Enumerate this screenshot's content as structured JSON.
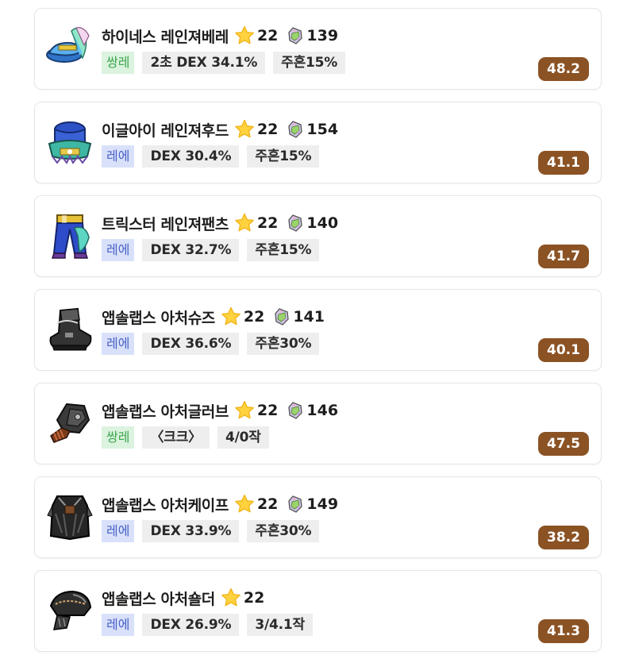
{
  "colors": {
    "score_badge": "#8b5224",
    "grade_ssang_bg": "#dcf3df",
    "grade_ssang_text": "#3aa64c",
    "grade_rare_bg": "#d9e1fa",
    "grade_rare_text": "#4a62c7",
    "stat_bg": "#eeeeee",
    "card_border": "#e6e6e6"
  },
  "items": [
    {
      "name": "하이네스 레인져베레",
      "icon": "highness-ranger-beret-icon",
      "stars": "22",
      "gem": "139",
      "grade": "쌍레",
      "grade_type": "ssang",
      "stats": [
        "2초 DEX 34.1%",
        "주흔15%"
      ],
      "score": "48.2"
    },
    {
      "name": "이글아이 레인져후드",
      "icon": "eagle-eye-ranger-hood-icon",
      "stars": "22",
      "gem": "154",
      "grade": "레에",
      "grade_type": "rare",
      "stats": [
        "DEX 30.4%",
        "주흔15%"
      ],
      "score": "41.1"
    },
    {
      "name": "트릭스터 레인져팬츠",
      "icon": "trickster-ranger-pants-icon",
      "stars": "22",
      "gem": "140",
      "grade": "레에",
      "grade_type": "rare",
      "stats": [
        "DEX 32.7%",
        "주흔15%"
      ],
      "score": "41.7"
    },
    {
      "name": "앱솔랩스 아처슈즈",
      "icon": "absolab-archer-shoes-icon",
      "stars": "22",
      "gem": "141",
      "grade": "레에",
      "grade_type": "rare",
      "stats": [
        "DEX 36.6%",
        "주흔30%"
      ],
      "score": "40.1"
    },
    {
      "name": "앱솔랩스 아처글러브",
      "icon": "absolab-archer-glove-icon",
      "stars": "22",
      "gem": "146",
      "grade": "쌍레",
      "grade_type": "ssang",
      "stats": [
        "〈크크〉",
        "4/0작"
      ],
      "score": "47.5"
    },
    {
      "name": "앱솔랩스 아처케이프",
      "icon": "absolab-archer-cape-icon",
      "stars": "22",
      "gem": "149",
      "grade": "레에",
      "grade_type": "rare",
      "stats": [
        "DEX 33.9%",
        "주흔30%"
      ],
      "score": "38.2"
    },
    {
      "name": "앱솔랩스 아처숄더",
      "icon": "absolab-archer-shoulder-icon",
      "stars": "22",
      "gem": "",
      "grade": "레에",
      "grade_type": "rare",
      "stats": [
        "DEX 26.9%",
        "3/4.1작"
      ],
      "score": "41.3"
    }
  ]
}
